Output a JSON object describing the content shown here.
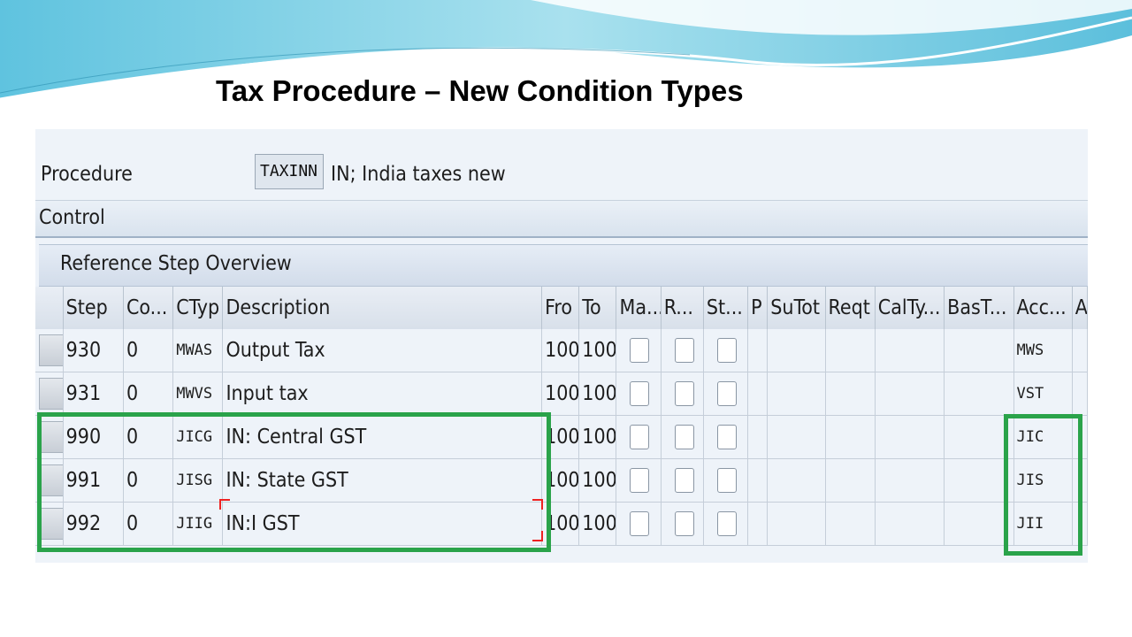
{
  "slide": {
    "title": "Tax Procedure – New Condition Types"
  },
  "procedure": {
    "label": "Procedure",
    "value": "TAXINN",
    "description": "IN; India taxes new"
  },
  "sections": {
    "control": "Control",
    "reference": "Reference Step Overview"
  },
  "columns": [
    "Step",
    "Co...",
    "CTyp",
    "Description",
    "Fro",
    "To",
    "Ma...",
    "R...",
    "St...",
    "P",
    "SuTot",
    "Reqt",
    "CalTy...",
    "BasT...",
    "Acc...",
    "A"
  ],
  "rows": [
    {
      "step": "930",
      "counter": "0",
      "ctyp": "MWAS",
      "description": "Output Tax",
      "from": "100",
      "to": "100",
      "account": "MWS"
    },
    {
      "step": "931",
      "counter": "0",
      "ctyp": "MWVS",
      "description": "Input tax",
      "from": "100",
      "to": "100",
      "account": "VST"
    },
    {
      "step": "990",
      "counter": "0",
      "ctyp": "JICG",
      "description": "IN: Central GST",
      "from": "100",
      "to": "100",
      "account": "JIC"
    },
    {
      "step": "991",
      "counter": "0",
      "ctyp": "JISG",
      "description": "IN: State GST",
      "from": "100",
      "to": "100",
      "account": "JIS"
    },
    {
      "step": "992",
      "counter": "0",
      "ctyp": "JIIG",
      "description": "IN:I GST",
      "from": "100",
      "to": "100",
      "account": "JII"
    }
  ],
  "colors": {
    "highlight": "#2aa34a",
    "accent_wave": "#7fd0e6"
  }
}
